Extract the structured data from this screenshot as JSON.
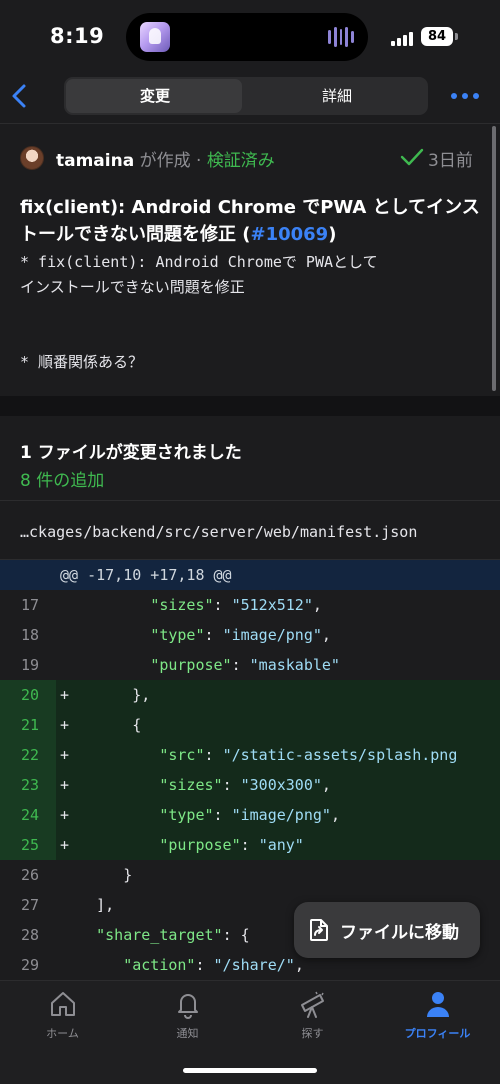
{
  "status_bar": {
    "time": "8:19",
    "battery": "84"
  },
  "nav": {
    "tabs": [
      "変更",
      "詳細"
    ],
    "active_tab": "変更"
  },
  "commit": {
    "author": "tamaina",
    "created_suffix": " が作成 · ",
    "verified": "検証済み",
    "time_ago": "3日前",
    "title": "fix(client): Android Chrome でPWA としてインストールできない問題を修正 (",
    "pr": "#10069",
    "title_end": ")",
    "body": "* fix(client): Android Chromeで PWAとして\nインストールできない問題を修正\n\n\n* 順番関係ある？"
  },
  "files": {
    "title": "1 ファイルが変更されました",
    "additions": "8 件の追加",
    "path": "…ckages/backend/src/server/web/manifest.json"
  },
  "diff": {
    "hunk": "@@ -17,10 +17,18 @@",
    "rows": [
      {
        "type": "ctx",
        "num": "17",
        "sign": "",
        "indent": "          ",
        "key": "\"sizes\"",
        "sep": ": ",
        "val": "\"512x512\"",
        "end": ","
      },
      {
        "type": "ctx",
        "num": "18",
        "sign": "",
        "indent": "          ",
        "key": "\"type\"",
        "sep": ": ",
        "val": "\"image/png\"",
        "end": ","
      },
      {
        "type": "ctx",
        "num": "19",
        "sign": "",
        "indent": "          ",
        "key": "\"purpose\"",
        "sep": ": ",
        "val": "\"maskable\"",
        "end": ""
      },
      {
        "type": "add",
        "num": "20",
        "sign": "+",
        "indent": "       ",
        "key": "",
        "sep": "",
        "val": "",
        "end": "},"
      },
      {
        "type": "add",
        "num": "21",
        "sign": "+",
        "indent": "       ",
        "key": "",
        "sep": "",
        "val": "",
        "end": "{"
      },
      {
        "type": "add",
        "num": "22",
        "sign": "+",
        "indent": "          ",
        "key": "\"src\"",
        "sep": ": ",
        "val": "\"/static-assets/splash.png",
        "end": ""
      },
      {
        "type": "add",
        "num": "23",
        "sign": "+",
        "indent": "          ",
        "key": "\"sizes\"",
        "sep": ": ",
        "val": "\"300x300\"",
        "end": ","
      },
      {
        "type": "add",
        "num": "24",
        "sign": "+",
        "indent": "          ",
        "key": "\"type\"",
        "sep": ": ",
        "val": "\"image/png\"",
        "end": ","
      },
      {
        "type": "add",
        "num": "25",
        "sign": "+",
        "indent": "          ",
        "key": "\"purpose\"",
        "sep": ": ",
        "val": "\"any\"",
        "end": ""
      },
      {
        "type": "ctx",
        "num": "26",
        "sign": "",
        "indent": "       ",
        "key": "",
        "sep": "",
        "val": "",
        "end": "}"
      },
      {
        "type": "ctx",
        "num": "27",
        "sign": "",
        "indent": "    ",
        "key": "",
        "sep": "",
        "val": "",
        "end": "],"
      },
      {
        "type": "ctx",
        "num": "28",
        "sign": "",
        "indent": "    ",
        "key": "\"share_target\"",
        "sep": ": ",
        "val": "",
        "end": "{"
      },
      {
        "type": "ctx",
        "num": "29",
        "sign": "",
        "indent": "       ",
        "key": "\"action\"",
        "sep": ": ",
        "val": "\"/share/\"",
        "end": ","
      }
    ]
  },
  "fab": {
    "label": "ファイルに移動"
  },
  "tabbar": {
    "items": [
      {
        "label": "ホーム",
        "icon": "home-icon"
      },
      {
        "label": "通知",
        "icon": "bell-icon"
      },
      {
        "label": "探す",
        "icon": "telescope-icon"
      },
      {
        "label": "プロフィール",
        "icon": "profile-icon"
      }
    ],
    "active": "プロフィール"
  },
  "colors": {
    "accent": "#3b82f6",
    "added": "#3fb950",
    "background": "#1c1c1e"
  }
}
